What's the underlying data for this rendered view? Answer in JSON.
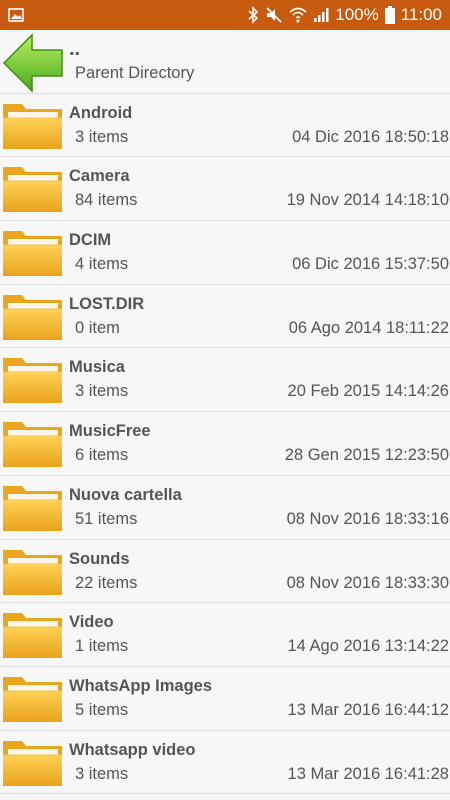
{
  "status_bar": {
    "battery": "100%",
    "time": "11:00",
    "left_icon": "gallery-icon",
    "icons": [
      "bluetooth-icon",
      "mute-icon",
      "wifi-icon",
      "signal-icon",
      "battery-icon"
    ],
    "color": "#c85a0f"
  },
  "parent": {
    "name": "..",
    "label": "Parent Directory",
    "icon": "back-arrow-icon"
  },
  "folders": [
    {
      "name": "Android",
      "count": "3 items",
      "date": "04 Dic 2016 18:50:18"
    },
    {
      "name": "Camera",
      "count": "84 items",
      "date": "19 Nov 2014 14:18:10"
    },
    {
      "name": "DCIM",
      "count": "4 items",
      "date": "06 Dic 2016 15:37:50"
    },
    {
      "name": "LOST.DIR",
      "count": "0 item",
      "date": "06 Ago 2014 18:11:22"
    },
    {
      "name": "Musica",
      "count": "3 items",
      "date": "20 Feb 2015 14:14:26"
    },
    {
      "name": "MusicFree",
      "count": "6 items",
      "date": "28 Gen 2015 12:23:50"
    },
    {
      "name": "Nuova cartella",
      "count": "51 items",
      "date": "08 Nov 2016 18:33:16"
    },
    {
      "name": "Sounds",
      "count": "22 items",
      "date": "08 Nov 2016 18:33:30"
    },
    {
      "name": "Video",
      "count": "1 items",
      "date": "14 Ago 2016 13:14:22"
    },
    {
      "name": "WhatsApp Images",
      "count": "5 items",
      "date": "13 Mar 2016 16:44:12"
    },
    {
      "name": "Whatsapp video",
      "count": "3 items",
      "date": "13 Mar 2016 16:41:28"
    }
  ]
}
